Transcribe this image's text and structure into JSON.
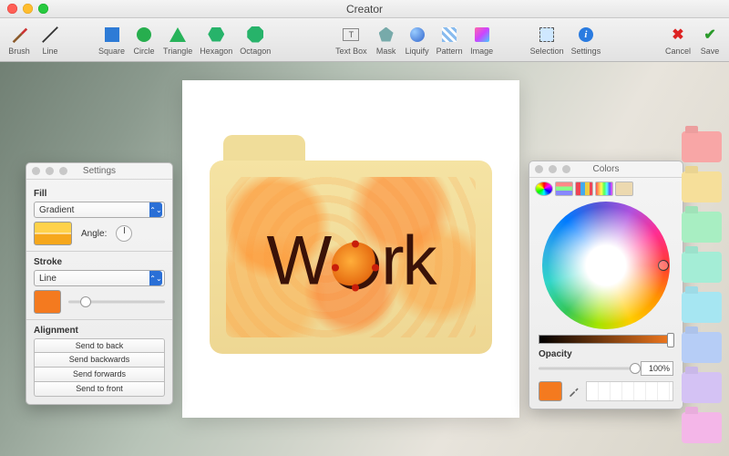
{
  "window": {
    "title": "Creator"
  },
  "toolbar": {
    "brush": "Brush",
    "line": "Line",
    "square": "Square",
    "circle": "Circle",
    "triangle": "Triangle",
    "hexagon": "Hexagon",
    "octagon": "Octagon",
    "textbox": "Text Box",
    "mask": "Mask",
    "liquify": "Liquify",
    "pattern": "Pattern",
    "image": "Image",
    "selection": "Selection",
    "settings": "Settings",
    "cancel": "Cancel",
    "save": "Save"
  },
  "canvas": {
    "folder_label_prefix": "W",
    "folder_label_suffix": "rk"
  },
  "settings_panel": {
    "title": "Settings",
    "fill_label": "Fill",
    "fill_mode": "Gradient",
    "angle_label": "Angle:",
    "gradient_colors": [
      "#ffd24a",
      "#f6a71c"
    ],
    "stroke_label": "Stroke",
    "stroke_mode": "Line",
    "stroke_color": "#f47a1f",
    "stroke_slider_pct": 18,
    "alignment_label": "Alignment",
    "align_back": "Send to back",
    "align_backwards": "Send backwards",
    "align_forwards": "Send forwards",
    "align_front": "Send to front"
  },
  "colors_panel": {
    "title": "Colors",
    "opacity_label": "Opacity",
    "opacity_value": "100%",
    "current_color": "#f47a1f",
    "brightness_slider_pct": 100
  },
  "swatches": [
    "#f8a6a6",
    "#f6df9a",
    "#a8eec2",
    "#a4edd6",
    "#a6e6f2",
    "#b6cdf6",
    "#d4c2f4",
    "#f4b6e8"
  ]
}
